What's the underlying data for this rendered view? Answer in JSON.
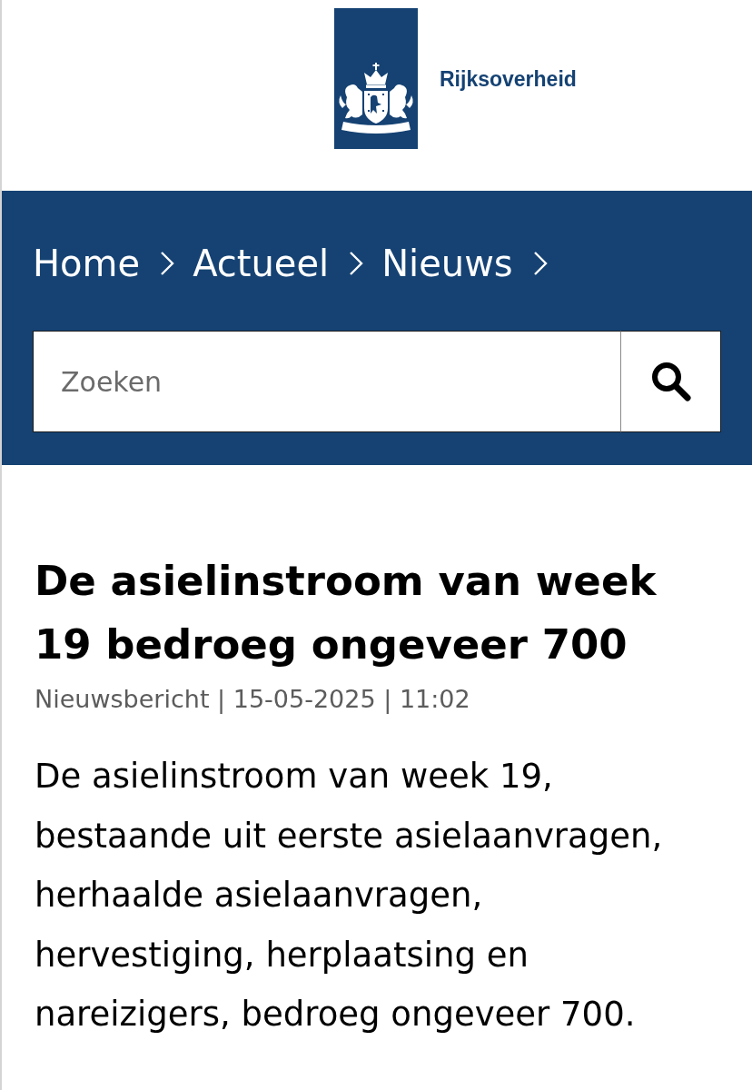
{
  "header": {
    "site_name": "Rijksoverheid"
  },
  "breadcrumb": [
    {
      "label": "Home"
    },
    {
      "label": "Actueel"
    },
    {
      "label": "Nieuws"
    }
  ],
  "search": {
    "placeholder": "Zoeken"
  },
  "article": {
    "title": "De asielinstroom van week 19 bedroeg ongeveer 700",
    "meta": "Nieuwsbericht | 15-05-2025 | 11:02",
    "lead": "De asielinstroom van week 19, bestaande uit eerste asielaanvragen, herhaalde asielaanvragen, hervestiging, herplaatsing en nareizigers, bedroeg ongeveer 700."
  }
}
